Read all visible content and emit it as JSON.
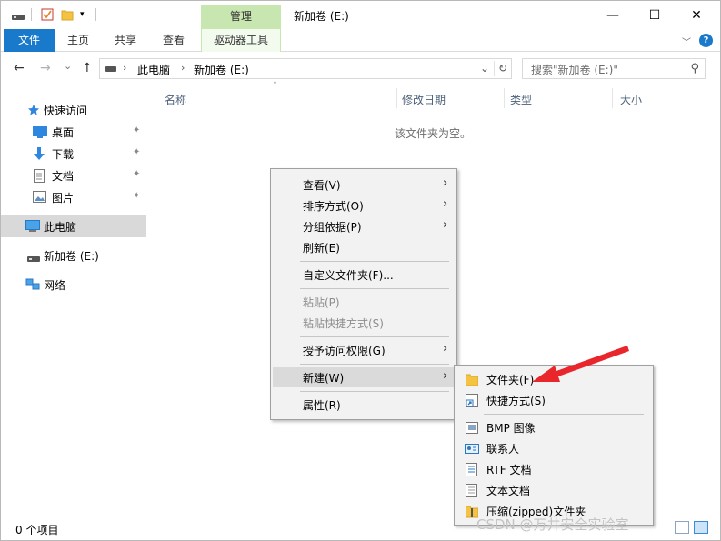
{
  "titlebar": {
    "manage_label": "管理",
    "title": "新加卷 (E:)",
    "minimize": "—",
    "maximize": "☐",
    "close": "✕"
  },
  "ribbon": {
    "tabs": [
      "文件",
      "主页",
      "共享",
      "查看",
      "驱动器工具"
    ],
    "chevron": "﹀",
    "help": "?"
  },
  "nav": {
    "back": "←",
    "forward": "→",
    "history": "⌄",
    "up": "↑",
    "breadcrumb": [
      "此电脑",
      "新加卷 (E:)"
    ],
    "separator": "›",
    "refresh": "↻",
    "dropdown": "⌄",
    "search_placeholder": "搜索\"新加卷 (E:)\"",
    "search_icon": "⚲"
  },
  "sidebar": {
    "quick_access": "快速访问",
    "items": [
      "桌面",
      "下载",
      "文档",
      "图片"
    ],
    "pin": "✦",
    "this_pc": "此电脑",
    "drive": "新加卷 (E:)",
    "network": "网络"
  },
  "content": {
    "columns": [
      "名称",
      "修改日期",
      "类型",
      "大小"
    ],
    "sort_indicator": "˄",
    "empty_message": "该文件夹为空。"
  },
  "status": {
    "item_count": "0 个项目"
  },
  "context_menu": {
    "arrow": "›",
    "items": [
      "查看(V)",
      "排序方式(O)",
      "分组依据(P)",
      "刷新(E)",
      "自定义文件夹(F)...",
      "粘贴(P)",
      "粘贴快捷方式(S)",
      "授予访问权限(G)",
      "新建(W)",
      "属性(R)"
    ]
  },
  "submenu": {
    "items": [
      "文件夹(F)",
      "快捷方式(S)",
      "BMP 图像",
      "联系人",
      "RTF 文档",
      "文本文档",
      "压缩(zipped)文件夹"
    ]
  },
  "watermark": "CSDN @万井安全实验室",
  "colors": {
    "accent": "#1979ca",
    "manage_tab": "#c8e6b0",
    "annotation": "#e8262b",
    "folder": "#f5c342"
  }
}
